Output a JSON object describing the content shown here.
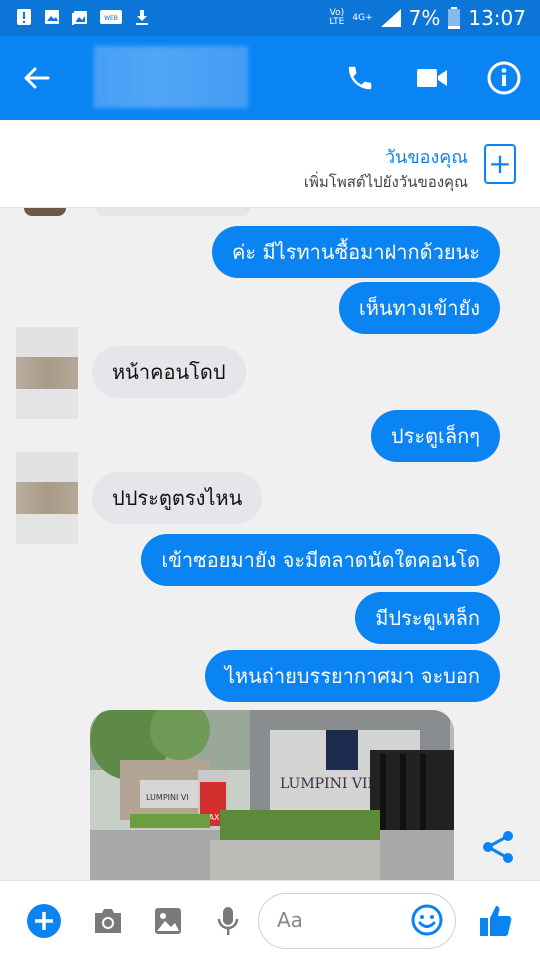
{
  "status_bar": {
    "network_top": "Vo)",
    "network_bottom": "LTE",
    "net_gen": "4G+",
    "battery": "7%",
    "time": "13:07"
  },
  "header": {
    "back_icon": "arrow-left-icon",
    "call_icon": "phone-icon",
    "video_icon": "video-camera-icon",
    "info_icon": "info-circle-icon"
  },
  "story": {
    "title": "วันของคุณ",
    "subtitle": "เพิ่มโพสต์ไปยังวันของคุณ"
  },
  "messages": [
    {
      "dir": "out",
      "text": "ค่ะ มีไรทานซื้อมาฝากด้วยนะ"
    },
    {
      "dir": "out",
      "text": "เห็นทางเข้ายัง"
    },
    {
      "dir": "in",
      "text": "หน้าคอนโดป"
    },
    {
      "dir": "out",
      "text": "ประตูเล็กๆ"
    },
    {
      "dir": "in",
      "text": "ปประตูตรงไหน"
    },
    {
      "dir": "out",
      "text": "เข้าซอยมายัง จะมีตลาดนัดใตคอนโด"
    },
    {
      "dir": "out",
      "text": "มีประตูเหล็ก"
    },
    {
      "dir": "out",
      "text": "ไหนถ่ายบรรยากาศมา จะบอก"
    }
  ],
  "photo": {
    "sign_text": "LUMPINI VILLE",
    "sign_left": "LUMPINI VI",
    "taxi_label": "TAXI"
  },
  "composer": {
    "placeholder": "Aa",
    "colors": {
      "accent": "#0b84f3"
    }
  }
}
